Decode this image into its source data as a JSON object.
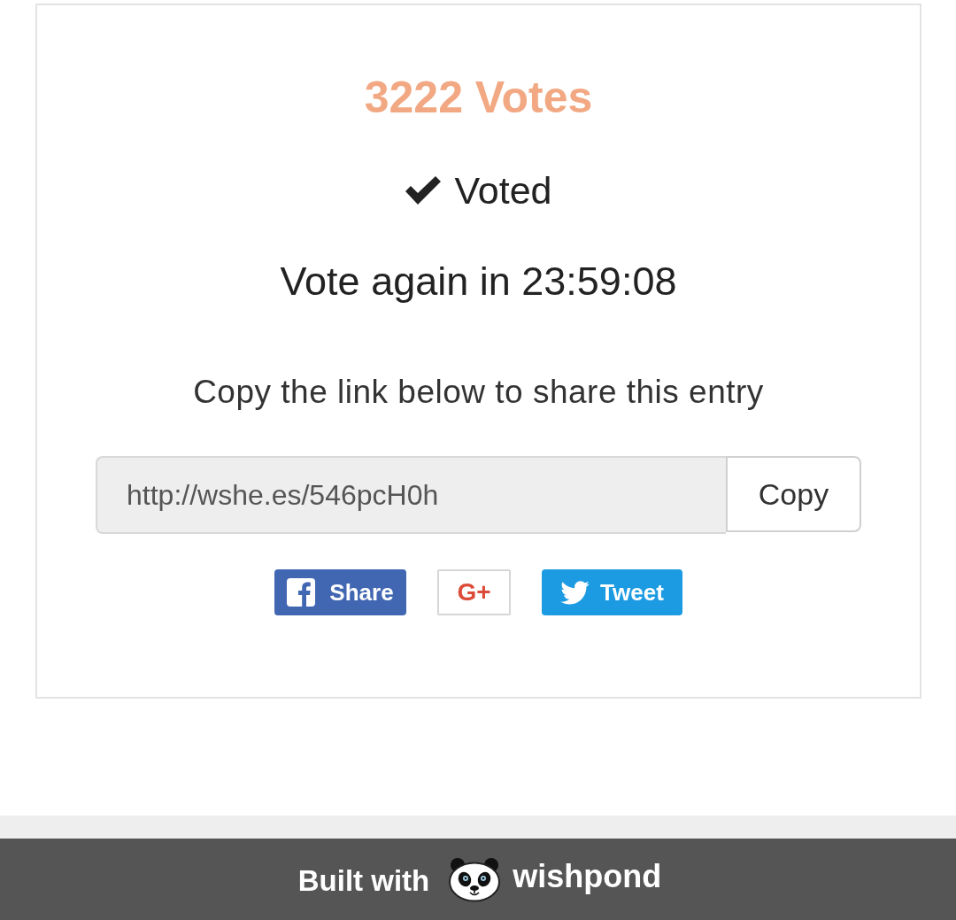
{
  "card": {
    "vote_count": "3222 Votes",
    "status": {
      "voted": true,
      "label": "Voted"
    },
    "countdown": "Vote again in 23:59:08",
    "share_prompt": "Copy the link below to share this entry",
    "link_field": {
      "value": "http://wshe.es/546pcH0h"
    },
    "copy_button": "Copy",
    "social_buttons": [
      {
        "kind": "facebook",
        "label": "Share"
      },
      {
        "kind": "google",
        "label": "G+"
      },
      {
        "kind": "twitter",
        "label": "Tweet"
      }
    ]
  },
  "footer": {
    "prefix": "Built with",
    "brand": "wishpond"
  }
}
